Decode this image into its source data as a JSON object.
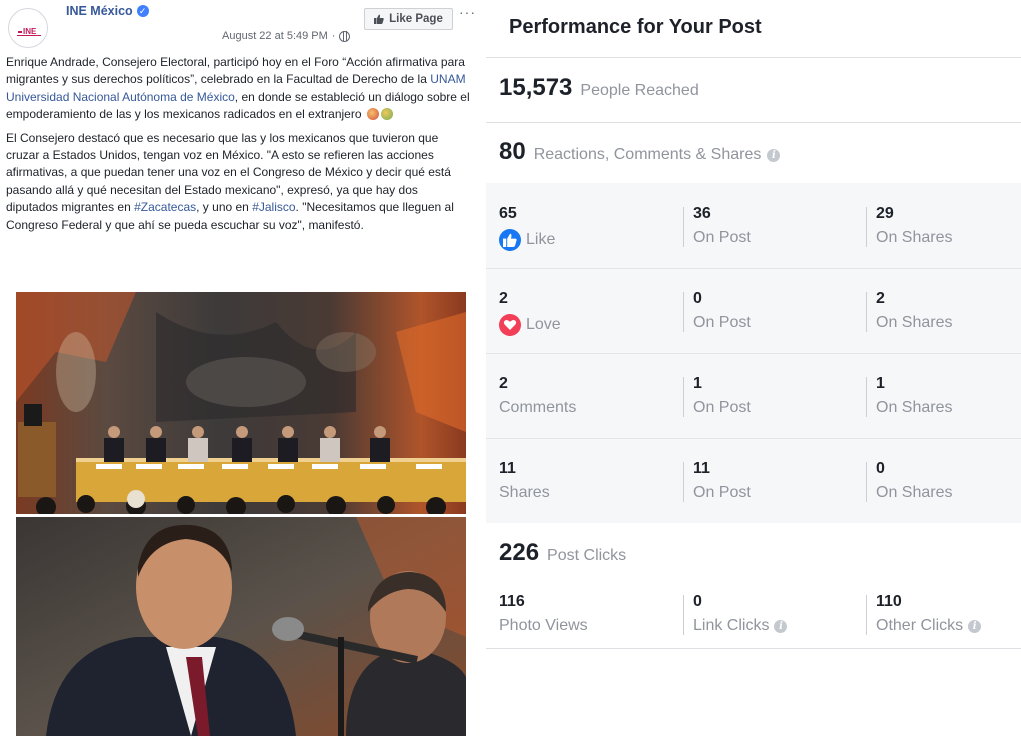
{
  "post": {
    "page_name": "INE México",
    "avatar_text": "INE",
    "timestamp": "August 22 at 5:49 PM",
    "like_page_label": "Like Page",
    "more_label": "···",
    "paragraph1_a": "Enrique Andrade, Consejero Electoral, participó hoy en el Foro “Acción afirmativa para migrantes y sus derechos políticos”, celebrado en la Facultad de Derecho de la ",
    "paragraph1_link": "UNAM Universidad Nacional Autónoma de México",
    "paragraph1_b": ", en donde se estableció un diálogo sobre el empoderamiento de las y los mexicanos radicados en el extranjero",
    "paragraph2_a": "El Consejero destacó que es necesario que las y los mexicanos que tuvieron que cruzar a Estados Unidos, tengan voz en México. \"A esto se refieren las acciones afirmativas, a que puedan tener una voz en el Congreso de México y decir qué está pasando allá y qué necesitan del Estado mexicano\", expresó, ya que hay dos diputados migrantes en ",
    "hashtag1": "#Zacatecas",
    "paragraph2_b": ", y uno en ",
    "hashtag2": "#Jalisco",
    "paragraph2_c": ". \"Necesitamos que lleguen al Congreso Federal y que ahí se pueda escuchar su voz\", manifestó."
  },
  "performance": {
    "title": "Performance for Your Post",
    "reached": {
      "value": "15,573",
      "label": "People Reached"
    },
    "engagement": {
      "value": "80",
      "label": "Reactions, Comments & Shares"
    },
    "rows": [
      {
        "total": "65",
        "label": "Like",
        "on_post": "36",
        "on_post_label": "On Post",
        "on_shares": "29",
        "on_shares_label": "On Shares"
      },
      {
        "total": "2",
        "label": "Love",
        "on_post": "0",
        "on_post_label": "On Post",
        "on_shares": "2",
        "on_shares_label": "On Shares"
      },
      {
        "total": "2",
        "label": "Comments",
        "on_post": "1",
        "on_post_label": "On Post",
        "on_shares": "1",
        "on_shares_label": "On Shares"
      },
      {
        "total": "11",
        "label": "Shares",
        "on_post": "11",
        "on_post_label": "On Post",
        "on_shares": "0",
        "on_shares_label": "On Shares"
      }
    ],
    "clicks": {
      "value": "226",
      "label": "Post Clicks",
      "photo_views": "116",
      "photo_views_label": "Photo Views",
      "link_clicks": "0",
      "link_clicks_label": "Link Clicks",
      "other_clicks": "110",
      "other_clicks_label": "Other Clicks"
    },
    "info_glyph": "i",
    "colors": {
      "like_blue": "#1877f2",
      "love_red": "#f33e58",
      "link_blue": "#365899",
      "muted": "#90949c"
    }
  }
}
